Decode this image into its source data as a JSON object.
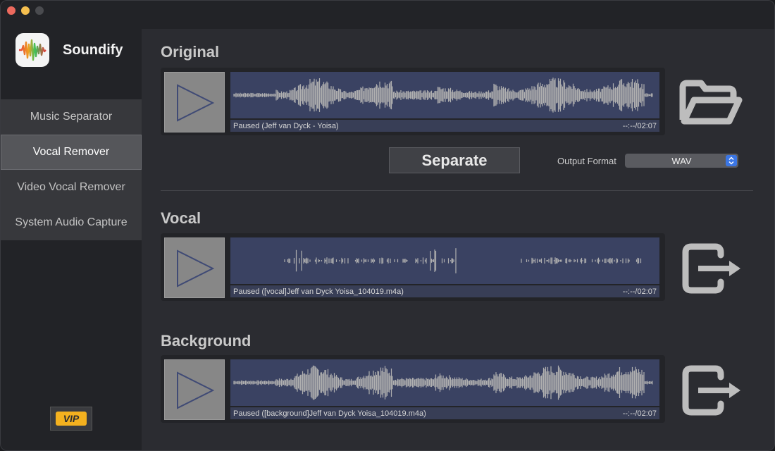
{
  "app": {
    "name": "Soundify",
    "icon": "waveform-app-icon"
  },
  "sidebar": {
    "items": [
      {
        "label": "Music Separator",
        "active": false
      },
      {
        "label": "Vocal Remover",
        "active": true
      },
      {
        "label": "Video Vocal Remover",
        "active": false
      },
      {
        "label": "System Audio Capture",
        "active": false
      }
    ],
    "vip_label": "VIP"
  },
  "original": {
    "title": "Original",
    "status": "Paused (Jeff van Dyck - Yoisa)",
    "time": "--:--/02:07",
    "action_icon": "folder-open-icon"
  },
  "controls": {
    "separate_label": "Separate",
    "output_format_label": "Output Format",
    "output_format_value": "WAV"
  },
  "vocal": {
    "title": "Vocal",
    "status": "Paused ([vocal]Jeff van Dyck  Yoisa_104019.m4a)",
    "time": "--:--/02:07",
    "action_icon": "export-icon"
  },
  "background": {
    "title": "Background",
    "status": "Paused ([background]Jeff van Dyck  Yoisa_104019.m4a)",
    "time": "--:--/02:07",
    "action_icon": "export-icon"
  },
  "colors": {
    "accent": "#3b76e4",
    "waveform": "#b0b0b0",
    "wave_bg": "#3a4262",
    "vip": "#f4b11f"
  }
}
